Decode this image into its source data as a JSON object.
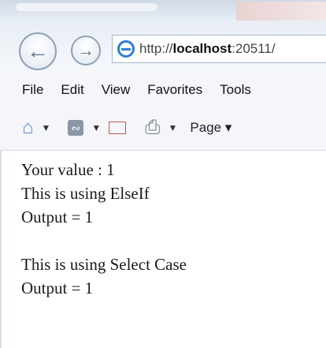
{
  "browser": {
    "address": {
      "prefix": "http://",
      "host": "localhost",
      "suffix": ":20511/"
    },
    "menu": [
      "File",
      "Edit",
      "View",
      "Favorites",
      "Tools"
    ],
    "toolbar": {
      "page_label": "Page ▾"
    }
  },
  "page": {
    "lines": [
      "Your value : 1",
      "This is using ElseIf",
      "Output = 1",
      "",
      "This is using Select Case",
      "Output = 1"
    ]
  }
}
